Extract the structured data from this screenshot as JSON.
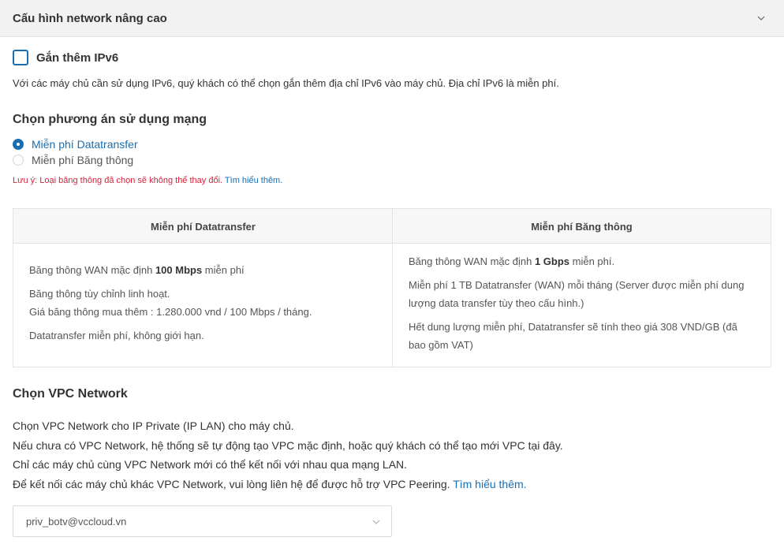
{
  "header": {
    "title": "Cấu hình network nâng cao",
    "toggle_icon": "chevron-down-icon"
  },
  "ipv6": {
    "checkbox_label": "Gắn thêm IPv6",
    "checked": false,
    "description": "Với các máy chủ cần sử dụng IPv6, quý khách có thể chọn gắn thêm địa chỉ IPv6 vào máy chủ. Địa chỉ IPv6 là miễn phí."
  },
  "network_plan": {
    "title": "Chọn phương án sử dụng mạng",
    "options": [
      {
        "label": "Miễn phí Datatransfer",
        "selected": true
      },
      {
        "label": "Miễn phí Băng thông",
        "selected": false
      }
    ],
    "note": "Lưu ý: Loại băng thông đã chọn sẽ không thể thay đổi.",
    "note_link": "Tìm hiểu thêm."
  },
  "comparison": {
    "col1": {
      "title": "Miễn phí Datatransfer",
      "l1_pre": "Băng thông WAN mặc định ",
      "l1_bold": "100 Mbps",
      "l1_post": " miễn phí",
      "l2a": "Băng thông tùy chỉnh linh hoạt.",
      "l2b": "Giá băng thông mua thêm : 1.280.000 vnd / 100 Mbps / tháng.",
      "l3": "Datatransfer miễn phí, không giới hạn."
    },
    "col2": {
      "title": "Miễn phí Băng thông",
      "l1_pre": "Băng thông WAN mặc định ",
      "l1_bold": "1 Gbps",
      "l1_post": " miễn phí.",
      "l2": "Miễn phí 1 TB Datatransfer (WAN) mỗi tháng (Server được miễn phí dung lượng data transfer tùy theo cấu hình.)",
      "l3": "Hết dung lượng miễn phí, Datatransfer sẽ tính theo giá 308 VND/GB (đã bao gồm VAT)"
    }
  },
  "vpc": {
    "title": "Chọn VPC Network",
    "line1": "Chọn VPC Network cho IP Private (IP LAN) cho máy chủ.",
    "line2": "Nếu chưa có VPC Network, hệ thống sẽ tự động tạo VPC mặc định, hoặc quý khách có thể tạo mới VPC tại đây.",
    "line3": "Chỉ các máy chủ cùng VPC Network mới có thể kết nối với nhau qua mạng LAN.",
    "line4": "Để kết nối các máy chủ khác VPC Network, vui lòng liên hệ để được hỗ trợ VPC Peering.",
    "line4_link": "Tìm hiểu thêm.",
    "selected": "priv_botv@vccloud.vn"
  },
  "colors": {
    "accent": "#1a6eb0",
    "warning": "#d9213a",
    "header_bg": "#f2f2f2"
  }
}
